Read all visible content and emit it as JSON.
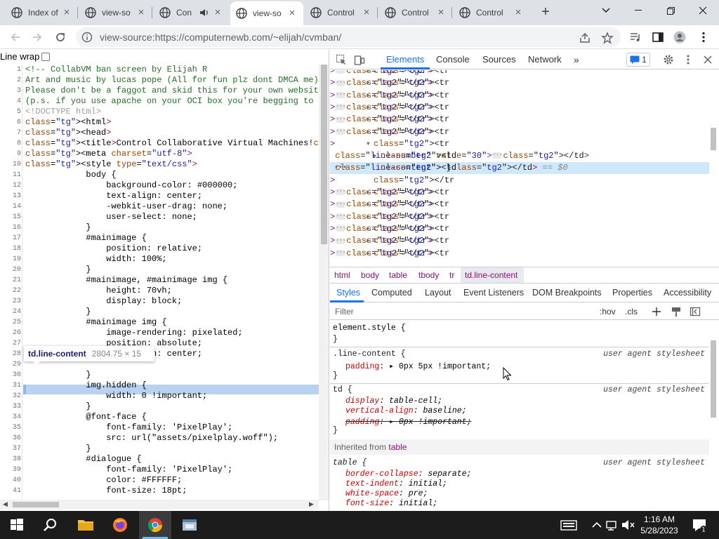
{
  "browser": {
    "tabs": [
      {
        "title": "Index of",
        "icon": "globe-icon",
        "active": false
      },
      {
        "title": "view-so",
        "icon": "globe-icon",
        "active": false
      },
      {
        "title": "Con",
        "icon": "globe-icon",
        "active": false,
        "audio": true
      },
      {
        "title": "view-so",
        "icon": "globe-icon",
        "active": true
      },
      {
        "title": "Control",
        "icon": "globe-icon",
        "active": false
      },
      {
        "title": "Control",
        "icon": "globe-icon",
        "active": false
      },
      {
        "title": "Control",
        "icon": "globe-icon",
        "active": false
      }
    ],
    "new_tab": "+",
    "url": "view-source:https://computernewb.com/~elijah/cvmban/"
  },
  "source": {
    "line_wrap_label": "Line wrap",
    "line_numbers": [
      "1",
      "2",
      "3",
      "4",
      "5",
      "6",
      "7",
      "8",
      "9",
      "10",
      "11",
      "12",
      "13",
      "14",
      "15",
      "16",
      "17",
      "18",
      "19",
      "20",
      "21",
      "22",
      "23",
      "24",
      "25",
      "26",
      "27",
      "28",
      "29",
      "30",
      "31",
      "32",
      "33",
      "34",
      "35",
      "36",
      "37",
      "38",
      "39",
      "40",
      "41"
    ],
    "lines": [
      "<!-- CollabVM ban screen by Elijah R",
      "Art and music by lucas pope (All for fun plz dont DMCA me)",
      "Please don't be a faggot and skid this for your own website",
      "(p.s. if you use apache on your OCI box you're begging to g",
      "<!DOCTYPE html>",
      "<html>",
      "<head>",
      "<title>Control Collaborative Virtual Machines!</title>",
      "<meta charset=\"utf-8\">",
      "<style type=\"text/css\">",
      "            body {",
      "                background-color: #000000;",
      "                text-align: center;",
      "                -webkit-user-drag: none;",
      "                user-select: none;",
      "            }",
      "            #mainimage {",
      "                position: relative;",
      "                width: 100%;",
      "            }",
      "            #mainimage, #mainimage img {",
      "                height: 70vh;",
      "                display: block;",
      "            }",
      "            #mainimage img {",
      "                image-rendering: pixelated;",
      "                position: absolute;",
      "                text-align: center;",
      "",
      "            }",
      "            img.hidden {",
      "                width: 0 !important;",
      "            }",
      "            @font-face {",
      "                font-family: 'PixelPlay';",
      "                src: url(\"assets/pixelplay.woff\");",
      "            }",
      "            #dialogue {",
      "                font-family: 'PixelPlay';",
      "                color: #FFFFFF;",
      "                font-size: 18pt;"
    ],
    "tooltip_selector": "td.line-content",
    "tooltip_size": "2804.75 × 15"
  },
  "devtools": {
    "tabs": [
      "Elements",
      "Console",
      "Sources",
      "Network"
    ],
    "more": "»",
    "issues_count": "1",
    "dom_rows": [
      {
        "indent": 0,
        "text": "<tr>…</tr>"
      },
      {
        "indent": 0,
        "text": "<tr>…</tr>"
      },
      {
        "indent": 0,
        "text": "<tr>…</tr>"
      },
      {
        "indent": 0,
        "text": "<tr>…</tr>"
      },
      {
        "indent": 0,
        "text": "<tr>…</tr>"
      },
      {
        "indent": 0,
        "text": "<tr>…</tr>"
      },
      {
        "indent": 0,
        "text": "<tr>"
      },
      {
        "indent": 1,
        "text": "<td class=\"line-number\" value=\"30\">…</td>"
      },
      {
        "indent": 1,
        "text": "<td class=\"line-content\"> }</td> == $0"
      },
      {
        "indent": 0,
        "text": "</tr>"
      },
      {
        "indent": 0,
        "text": "<tr>…</tr>"
      },
      {
        "indent": 0,
        "text": "<tr>…</tr>"
      },
      {
        "indent": 0,
        "text": "<tr>…</tr>"
      },
      {
        "indent": 0,
        "text": "<tr>…</tr>"
      },
      {
        "indent": 0,
        "text": "<tr>…</tr>"
      },
      {
        "indent": 0,
        "text": "<tr>…</tr>"
      }
    ],
    "breadcrumbs": [
      "html",
      "body",
      "table",
      "tbody",
      "tr",
      "td.line-content"
    ],
    "subtabs": [
      "Styles",
      "Computed",
      "Layout",
      "Event Listeners",
      "DOM Breakpoints",
      "Properties",
      "Accessibility"
    ],
    "filter_placeholder": "Filter",
    "hov": ":hov",
    "cls": ".cls",
    "element_style": "element.style {",
    "close_brace": "}",
    "rules": [
      {
        "selector": ".line-content {",
        "source": "user agent stylesheet",
        "props": [
          {
            "name": "padding",
            "value": "0px 5px !important;"
          }
        ]
      },
      {
        "selector": "td {",
        "source": "user agent stylesheet",
        "props": [
          {
            "name": "display",
            "value": "table-cell;"
          },
          {
            "name": "vertical-align",
            "value": "baseline;"
          },
          {
            "name": "padding",
            "value": "0px !important;"
          }
        ]
      }
    ],
    "inherited_label": "Inherited from",
    "inherited_from": "table",
    "table_rule": {
      "selector": "table {",
      "source": "user agent stylesheet",
      "props": [
        {
          "name": "border-collapse",
          "value": "separate;"
        },
        {
          "name": "text-indent",
          "value": "initial;"
        },
        {
          "name": "white-space",
          "value": "pre;"
        },
        {
          "name": "font-size",
          "value": "initial;"
        }
      ]
    }
  },
  "taskbar": {
    "time": "1:16 AM",
    "date": "5/28/2023"
  },
  "colors": {
    "accent": "#1a73e8",
    "tag": "#881280",
    "attr": "#994500",
    "attrval": "#1a1aa6",
    "comment": "#236e25"
  }
}
